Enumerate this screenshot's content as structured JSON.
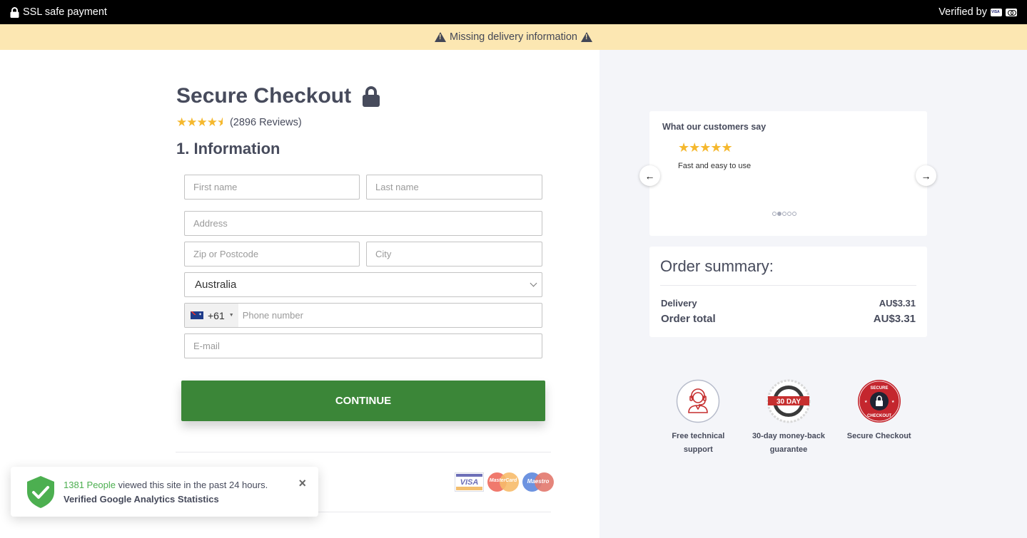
{
  "topbar": {
    "ssl_label": "SSL safe payment",
    "verified_label": "Verified by"
  },
  "alert": {
    "message": "Missing delivery information"
  },
  "checkout": {
    "title": "Secure Checkout",
    "rating": {
      "stars": 4.5,
      "reviews_label": "(2896 Reviews)"
    },
    "section_title": "1. Information",
    "fields": {
      "first_name": {
        "placeholder": "First name",
        "value": ""
      },
      "last_name": {
        "placeholder": "Last name",
        "value": ""
      },
      "address": {
        "placeholder": "Address",
        "value": ""
      },
      "zip": {
        "placeholder": "Zip or Postcode",
        "value": ""
      },
      "city": {
        "placeholder": "City",
        "value": ""
      },
      "country": {
        "selected": "Australia"
      },
      "phone": {
        "country_code": "+61",
        "placeholder": "Phone number",
        "value": ""
      },
      "email": {
        "placeholder": "E-mail",
        "value": ""
      }
    },
    "continue_label": "CONTINUE",
    "payment_cards": [
      "VISA",
      "MasterCard",
      "Maestro"
    ]
  },
  "toast": {
    "count_label": "1381 People",
    "message": " viewed this site in the past 24 hours.",
    "subtitle": "Verified Google Analytics Statistics",
    "close_icon": "×"
  },
  "testimonial": {
    "title": "What our customers say",
    "stars": "★★★★★",
    "quote": "Fast and easy to use",
    "prev_icon": "🡐",
    "next_icon": "🡒",
    "slide_count": 5,
    "active_slide": 2
  },
  "order_summary": {
    "title": "Order summary:",
    "rows": [
      {
        "label": "Delivery",
        "value": "AU$3.31"
      },
      {
        "label": "Order total",
        "value": "AU$3.31"
      }
    ]
  },
  "badges": [
    {
      "label": "Free technical support"
    },
    {
      "label": "30-day money-back guarantee",
      "badge_text": "30 DAY"
    },
    {
      "label": "Secure Checkout",
      "badge_top": "SECURE",
      "badge_bottom": "CHECKOUT"
    }
  ],
  "colors": {
    "accent_green": "#3b8638",
    "alert_bg": "#fce7b2",
    "star": "#f5b82e",
    "text": "#474b5c"
  }
}
